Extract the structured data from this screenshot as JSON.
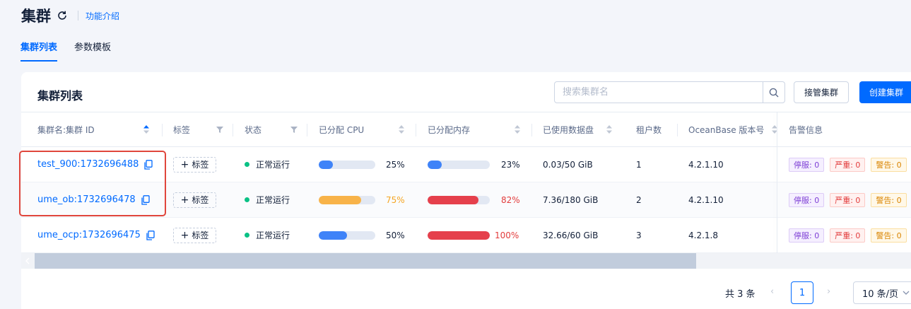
{
  "header": {
    "title": "集群",
    "intro_link": "功能介绍"
  },
  "tabs": [
    {
      "label": "集群列表",
      "active": true
    },
    {
      "label": "参数模板",
      "active": false
    }
  ],
  "card": {
    "title": "集群列表",
    "search_placeholder": "搜索集群名",
    "takeover_label": "接管集群",
    "create_label": "创建集群"
  },
  "table": {
    "headers": {
      "name": "集群名:集群 ID",
      "tags": "标签",
      "status": "状态",
      "cpu": "已分配 CPU",
      "mem": "已分配内存",
      "disk": "已使用数据盘",
      "tenants": "租户数",
      "version": "OceanBase 版本号",
      "alerts": "告警信息"
    },
    "rows": [
      {
        "name": "test_900:1732696488",
        "tag_label": "标签",
        "status": "正常运行",
        "cpu_pct": 25,
        "cpu_text": "25%",
        "mem_pct": 23,
        "mem_text": "23%",
        "disk": "0.03/50 GiB",
        "tenants": "1",
        "version": "4.2.1.10",
        "alert_down": "停服: 0",
        "alert_severe": "严重: 0",
        "alert_warn": "警告: 0"
      },
      {
        "name": "ume_ob:1732696478",
        "tag_label": "标签",
        "status": "正常运行",
        "cpu_pct": 75,
        "cpu_text": "75%",
        "mem_pct": 82,
        "mem_text": "82%",
        "disk": "7.36/180 GiB",
        "tenants": "2",
        "version": "4.2.1.10",
        "alert_down": "停服: 0",
        "alert_severe": "严重: 0",
        "alert_warn": "警告: 0"
      },
      {
        "name": "ume_ocp:1732696475",
        "tag_label": "标签",
        "status": "正常运行",
        "cpu_pct": 50,
        "cpu_text": "50%",
        "mem_pct": 100,
        "mem_text": "100%",
        "disk": "32.66/60 GiB",
        "tenants": "3",
        "version": "4.2.1.8",
        "alert_down": "停服: 0",
        "alert_severe": "严重: 0",
        "alert_warn": "警告: 0"
      }
    ]
  },
  "pager": {
    "total": "共 3 条",
    "current_page": "1",
    "page_size": "10 条/页"
  },
  "colors": {
    "primary": "#006aff",
    "bar_normal": "#3f83f8",
    "bar_warn": "#f8b349",
    "bar_danger": "#e5404c",
    "pct_warn": "#f5a623",
    "pct_danger": "#e23c3c",
    "highlight": "#e0463c"
  }
}
